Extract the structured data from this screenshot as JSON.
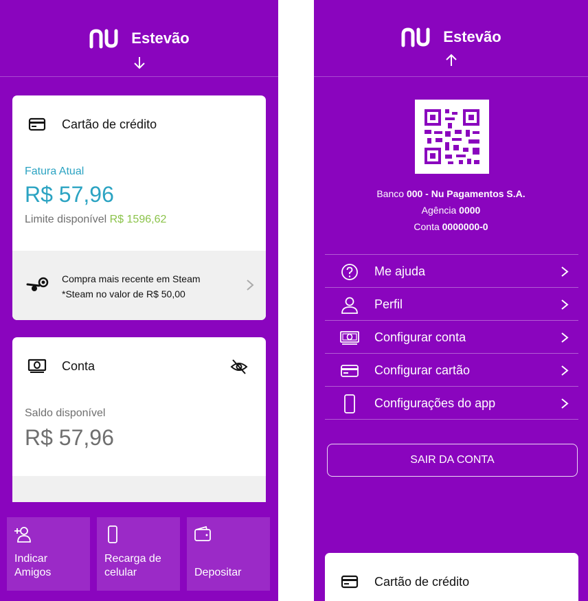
{
  "left": {
    "header": {
      "user_name": "Estevão"
    },
    "credit_card": {
      "title": "Cartão de crédito",
      "invoice_label": "Fatura Atual",
      "invoice_value": "R$ 57,96",
      "limit_label": "Limite disponível",
      "limit_value": "R$ 1596,62",
      "recent_line1": "Compra mais recente em Steam",
      "recent_line2": "*Steam no valor de R$ 50,00"
    },
    "account": {
      "title": "Conta",
      "balance_label": "Saldo disponível",
      "balance_value": "R$ 57,96"
    },
    "shortcuts": [
      {
        "label_line1": "Indicar",
        "label_line2": "Amigos",
        "icon": "add-person-icon"
      },
      {
        "label_line1": "Recarga de",
        "label_line2": "celular",
        "icon": "phone-icon"
      },
      {
        "label_line1": "Depositar",
        "label_line2": "",
        "icon": "wallet-icon"
      }
    ]
  },
  "right": {
    "header": {
      "user_name": "Estevão"
    },
    "bank": {
      "bank_label": "Banco",
      "bank_value": "000 - Nu Pagamentos S.A.",
      "agency_label": "Agência",
      "agency_value": "0000",
      "account_label": "Conta",
      "account_value": "0000000-0"
    },
    "menu": [
      {
        "label": "Me ajuda",
        "icon": "help-icon"
      },
      {
        "label": "Perfil",
        "icon": "profile-icon"
      },
      {
        "label": "Configurar conta",
        "icon": "money-icon"
      },
      {
        "label": "Configurar cartão",
        "icon": "card-icon"
      },
      {
        "label": "Configurações do app",
        "icon": "phone-icon"
      }
    ],
    "logout_label": "SAIR DA CONTA",
    "bottom_card_title": "Cartão de crédito"
  },
  "colors": {
    "brand_purple": "#8a05be",
    "teal": "#2ba3c2",
    "green": "#8bc34a",
    "grey_text": "#6f6f6f"
  }
}
